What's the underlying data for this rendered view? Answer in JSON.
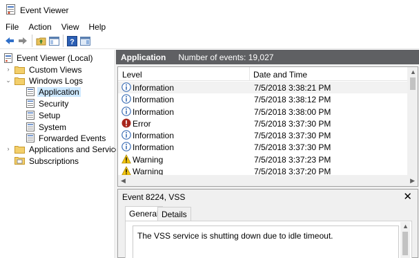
{
  "window": {
    "title": "Event Viewer"
  },
  "menu": [
    "File",
    "Action",
    "View",
    "Help"
  ],
  "toolbar": {
    "buttons": [
      "back-icon",
      "forward-icon",
      "up-folder-icon",
      "show-hide-tree-icon",
      "help-icon",
      "show-action-pane-icon"
    ]
  },
  "tree": {
    "root": "Event Viewer (Local)",
    "custom_views": "Custom Views",
    "windows_logs": "Windows Logs",
    "application": "Application",
    "security": "Security",
    "setup": "Setup",
    "system": "System",
    "forwarded_events": "Forwarded Events",
    "applications_services": "Applications and Services",
    "subscriptions": "Subscriptions"
  },
  "log_header": {
    "name": "Application",
    "count": "Number of events: 19,027"
  },
  "columns": {
    "level": "Level",
    "datetime": "Date and Time"
  },
  "events": [
    {
      "level": "Information",
      "type": "info",
      "datetime": "7/5/2018 3:38:21 PM"
    },
    {
      "level": "Information",
      "type": "info",
      "datetime": "7/5/2018 3:38:12 PM"
    },
    {
      "level": "Information",
      "type": "info",
      "datetime": "7/5/2018 3:38:00 PM"
    },
    {
      "level": "Error",
      "type": "error",
      "datetime": "7/5/2018 3:37:30 PM"
    },
    {
      "level": "Information",
      "type": "info",
      "datetime": "7/5/2018 3:37:30 PM"
    },
    {
      "level": "Information",
      "type": "info",
      "datetime": "7/5/2018 3:37:30 PM"
    },
    {
      "level": "Warning",
      "type": "warning",
      "datetime": "7/5/2018 3:37:23 PM"
    },
    {
      "level": "Warning",
      "type": "warning",
      "datetime": "7/5/2018 3:37:20 PM"
    }
  ],
  "detail": {
    "title": "Event 8224, VSS",
    "tabs": [
      "General",
      "Details"
    ],
    "message": "The VSS service is shutting down due to idle timeout."
  },
  "colors": {
    "header_bg": "#5f6063",
    "selection": "#cce8ff",
    "info": "#3d6fb5",
    "error": "#a8261c",
    "warning": "#f2c40f"
  }
}
